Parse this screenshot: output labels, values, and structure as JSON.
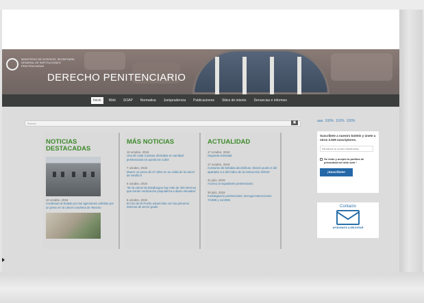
{
  "header": {
    "logo_text": "Ministerio de Interior, Secretaría General de Instituciones Penitenciarias",
    "site_title": "DERECHO PENITENCIARIO",
    "colors": {
      "nav_bg": "#3b3e3c",
      "accent_green": "#3c8a2a",
      "link_blue": "#3478a8"
    }
  },
  "nav": {
    "items": [
      {
        "label": "Inicio",
        "active": true
      },
      {
        "label": "Web"
      },
      {
        "label": "SOAP"
      },
      {
        "label": "Normativa"
      },
      {
        "label": "Jurisprudencia"
      },
      {
        "label": "Publicaciones"
      },
      {
        "label": "Sitios de interés"
      },
      {
        "label": "Denuncias e informes"
      }
    ]
  },
  "search": {
    "placeholder": "Buscar...",
    "button_icon": "search-icon",
    "button_label": "▣"
  },
  "zoom": {
    "options": [
      "100%",
      "110%",
      "120%"
    ],
    "prefix": "aaa"
  },
  "columns": {
    "noticias_destacadas": {
      "title": "NOTICIAS DESTACADAS",
      "photo_caption_date": "10 octubre, 2019",
      "photo_caption_text": "Condenan al Estado por las agresiones sufridas por un preso en la cárcel coruñesa de Teixeiro"
    },
    "mas_noticias": {
      "title": "MÁS NOTICIAS",
      "items": [
        {
          "date": "10 octubre, 2019",
          "text": "Una de cada 3 plazas ofertadas en sanidad penitenciaria se queda sin cubrir"
        },
        {
          "date": "7 octubre, 2019",
          "text": "Muere un preso de 27 años en su celda de la cárcel de Sevilla II"
        },
        {
          "date": "6 octubre, 2019",
          "text": "\"En la cárcel de Botafuegos hay más de 400 internos que toman medicación psiquiátrica a diario elevadas\""
        },
        {
          "date": "5 octubre, 2019",
          "text": "El CIS de El Puche estará listo con los primeros internos de tercer grado"
        }
      ]
    },
    "actualidad": {
      "title": "ACTUALIDAD",
      "items": [
        {
          "date": "17 octubre, 2019",
          "text": "Segunda actividad"
        },
        {
          "date": "17 octubre, 2019",
          "text": "Consumo de bebidas alcohólicas. Desvío punto 2 del apartado 3.4 del Índice de la Instrucción 3/2010"
        },
        {
          "date": "31 julio, 2019",
          "text": "Acceso al expediente penitenciario"
        },
        {
          "date": "30 julio, 2019",
          "text": "Investigación penitenciaria. Deroga instrucciones 7/1999 y 11/2005"
        }
      ]
    }
  },
  "subscribe": {
    "title": "Suscríbete a nuestro boletín y únete a otros 2.529 suscriptores.",
    "email_placeholder": "Introduce tu correo electrónico",
    "privacy_label": "He leído y acepto la política de privacidad del sitio web *",
    "button_label": "¡Suscríbete!"
  },
  "contact": {
    "title": "Contacto",
    "subtitle": "AYÚDANOS A MEJORAR",
    "icon": "envelope-icon"
  }
}
